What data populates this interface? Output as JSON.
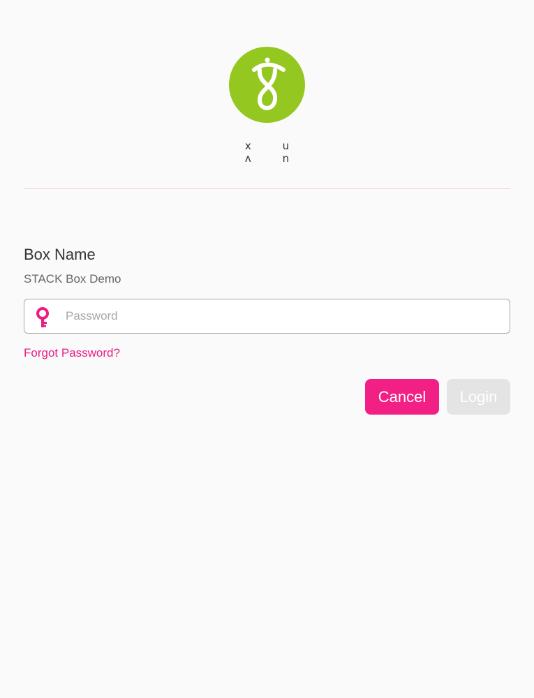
{
  "brand": {
    "wordmark": "x u ʌ n",
    "logo_color": "#95c721"
  },
  "box": {
    "label": "Box Name",
    "value": "STACK Box Demo"
  },
  "password": {
    "value": "",
    "placeholder": "Password",
    "icon": "key-icon"
  },
  "links": {
    "forgot_password": "Forgot Password?"
  },
  "buttons": {
    "cancel": "Cancel",
    "login": "Login"
  },
  "colors": {
    "accent": "#f21f85",
    "disabled": "#e4e4e4",
    "divider": "#f3c6d6"
  }
}
